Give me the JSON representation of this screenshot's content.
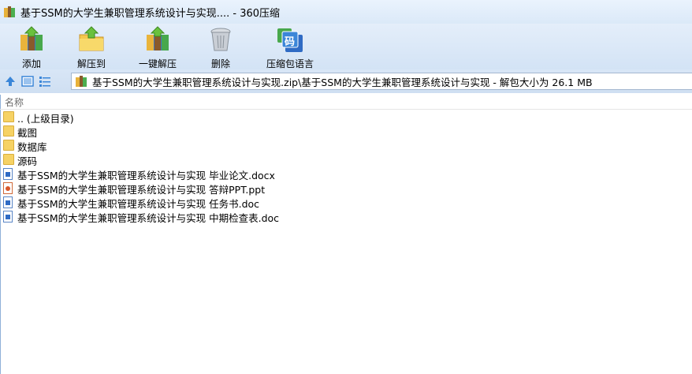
{
  "window": {
    "title": "基于SSM的大学生兼职管理系统设计与实现.... - 360压缩"
  },
  "toolbar": {
    "buttons": [
      {
        "label": "添加",
        "icon": "add-archive-icon"
      },
      {
        "label": "解压到",
        "icon": "extract-to-icon"
      },
      {
        "label": "一键解压",
        "icon": "one-click-extract-icon"
      },
      {
        "label": "删除",
        "icon": "delete-bin-icon"
      },
      {
        "label": "压缩包语言",
        "icon": "archive-language-icon"
      }
    ],
    "language_icon_glyph": "码"
  },
  "address": {
    "path": "基于SSM的大学生兼职管理系统设计与实现.zip\\基于SSM的大学生兼职管理系统设计与实现 - 解包大小为 26.1 MB"
  },
  "list": {
    "column_name": "名称",
    "items": [
      {
        "name": ".. (上级目录)",
        "type": "folder"
      },
      {
        "name": "截图",
        "type": "folder"
      },
      {
        "name": "数据库",
        "type": "folder"
      },
      {
        "name": "源码",
        "type": "folder"
      },
      {
        "name": "基于SSM的大学生兼职管理系统设计与实现 毕业论文.docx",
        "type": "doc"
      },
      {
        "name": "基于SSM的大学生兼职管理系统设计与实现 答辩PPT.ppt",
        "type": "ppt"
      },
      {
        "name": "基于SSM的大学生兼职管理系统设计与实现 任务书.doc",
        "type": "doc"
      },
      {
        "name": "基于SSM的大学生兼职管理系统设计与实现 中期检查表.doc",
        "type": "doc"
      }
    ]
  },
  "colors": {
    "accent": "#2f6bc4",
    "folder": "#f6d264",
    "bar_top": "#e4eefa"
  }
}
